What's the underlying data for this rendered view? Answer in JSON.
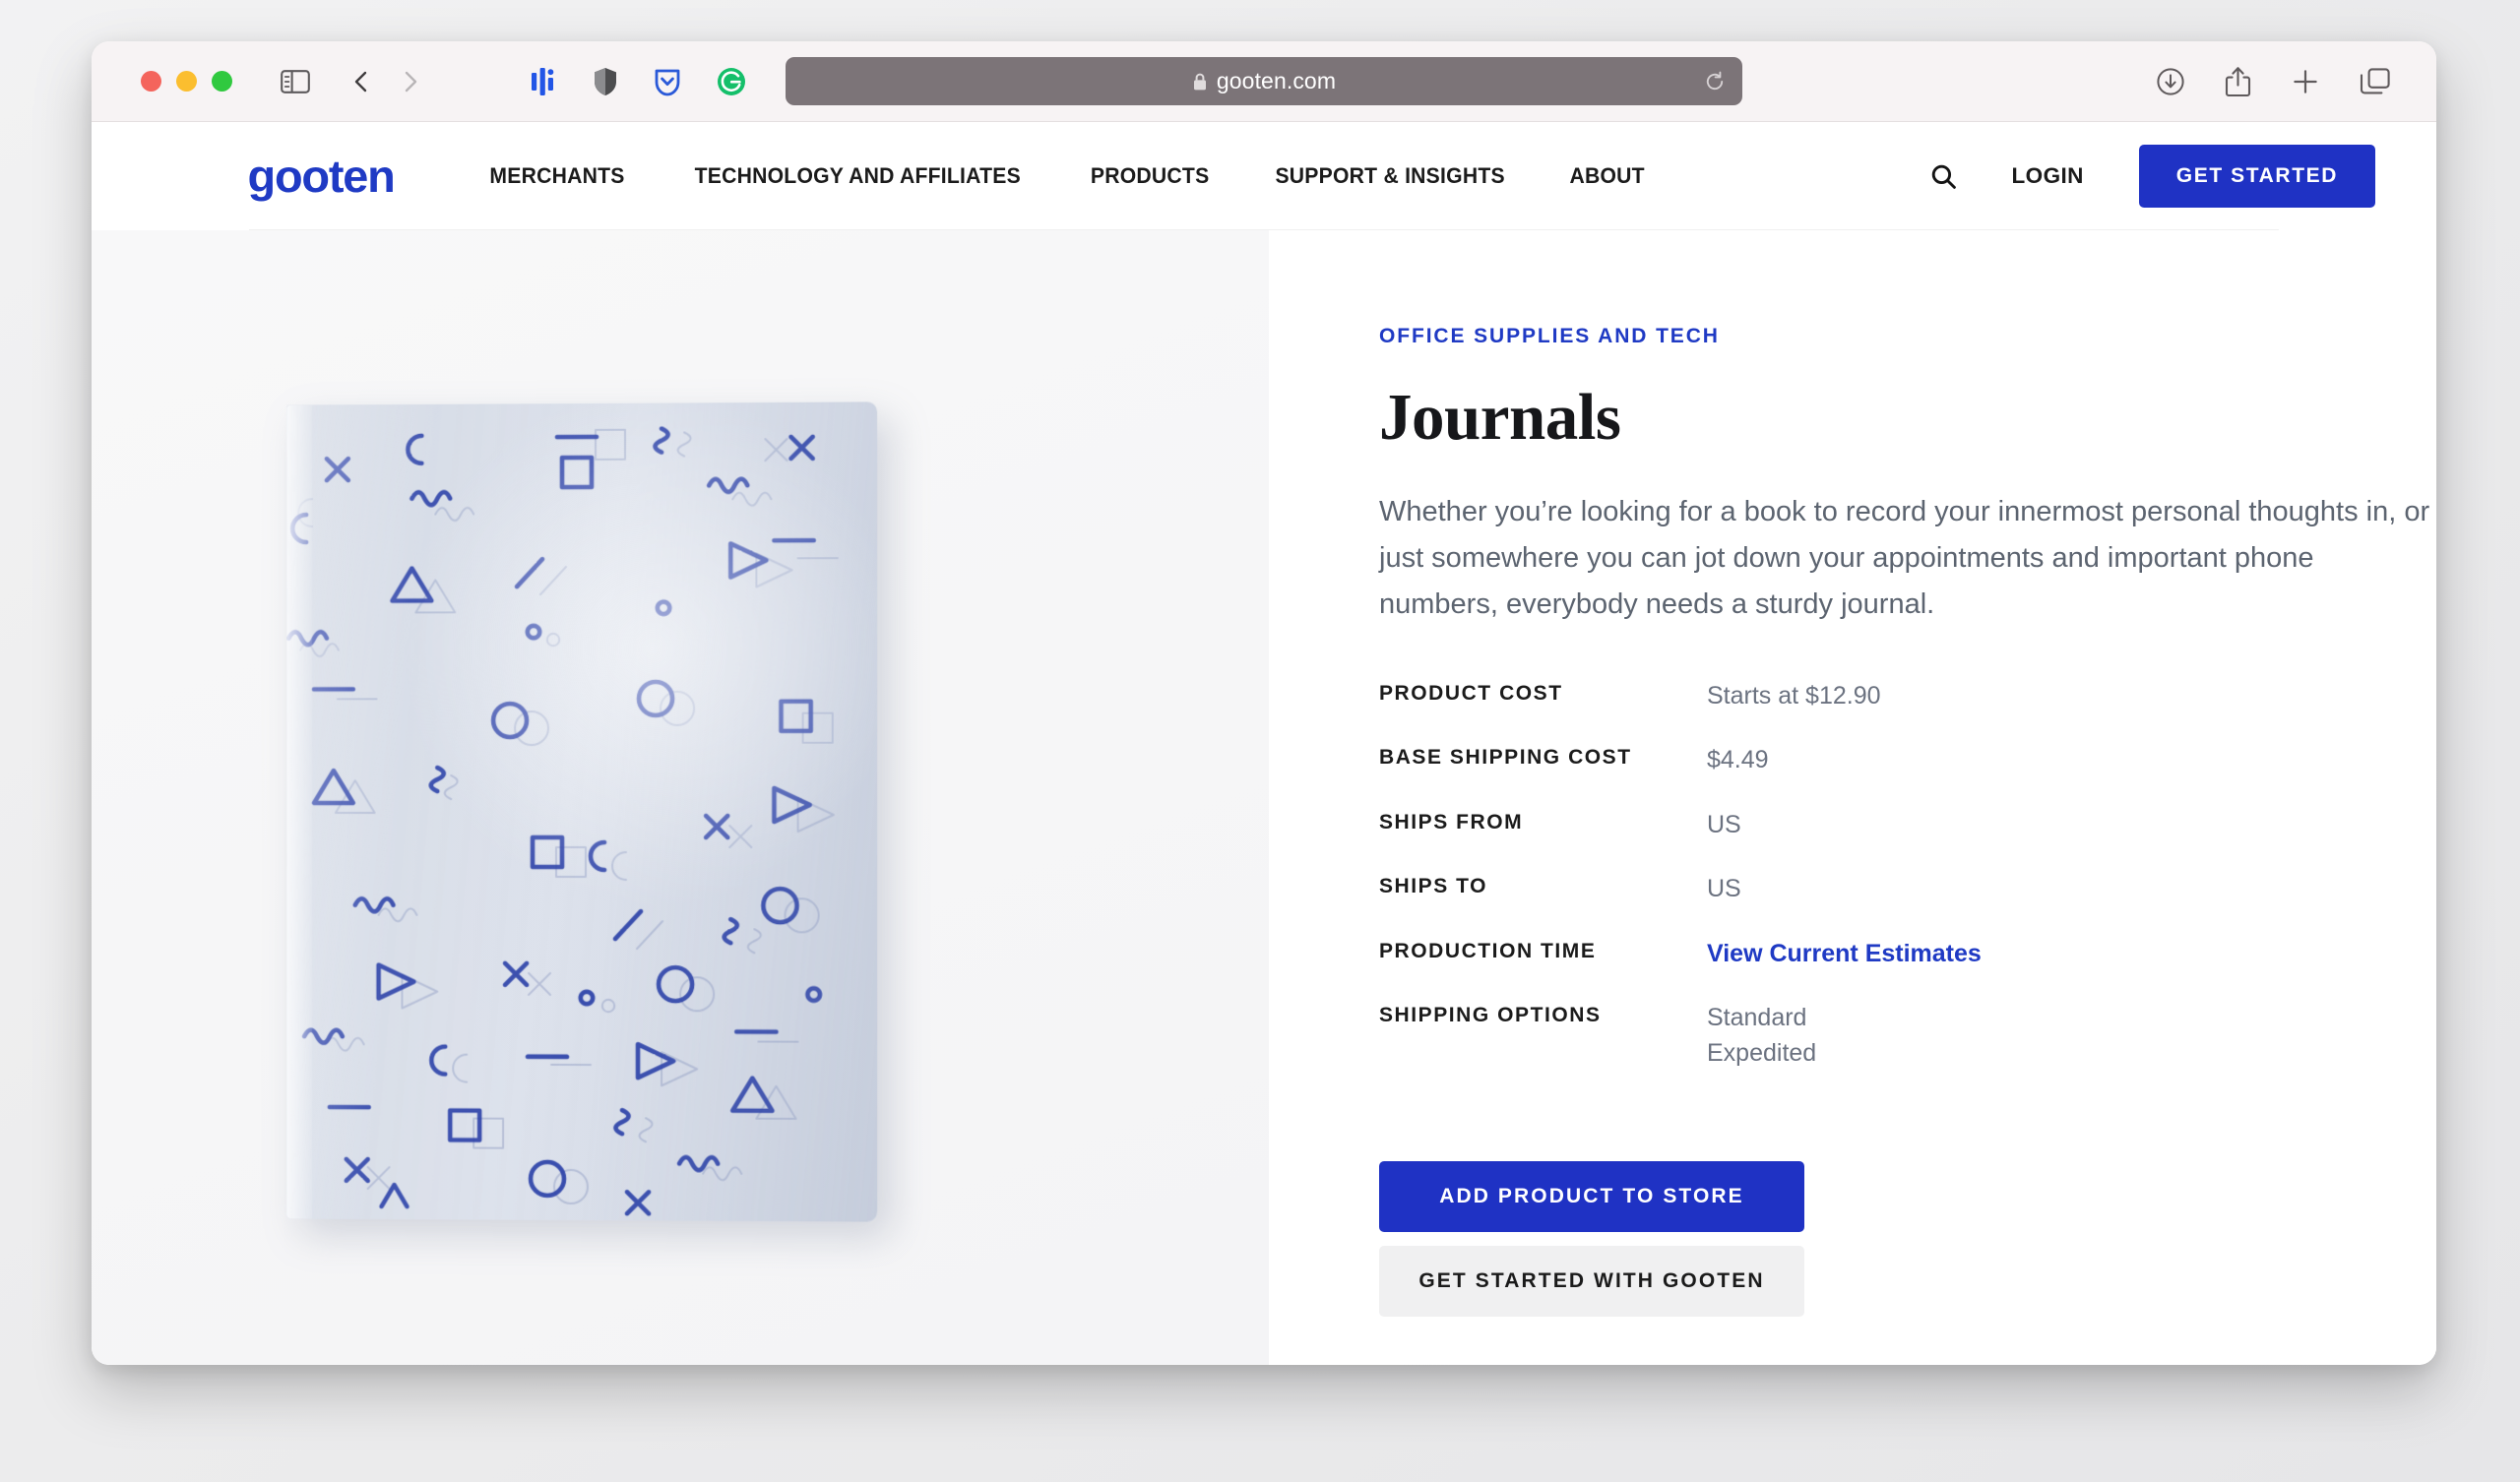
{
  "browser": {
    "traffic_lights": [
      "close",
      "minimize",
      "zoom"
    ],
    "sidebar_icon": "sidebar-icon",
    "back_icon": "chevron-left-icon",
    "forward_icon": "chevron-right-icon",
    "extensions": [
      "honey-extension-icon",
      "ghostery-shield-icon",
      "pocket-extension-icon",
      "grammarly-extension-icon"
    ],
    "address": {
      "lock_icon": "lock-icon",
      "url": "gooten.com",
      "reload_icon": "reload-icon"
    },
    "right_icons": [
      "downloads-icon",
      "share-icon",
      "new-tab-icon",
      "tab-overview-icon"
    ]
  },
  "site": {
    "logo_text": "gooten",
    "nav_items": [
      {
        "label": "MERCHANTS"
      },
      {
        "label": "TECHNOLOGY AND AFFILIATES"
      },
      {
        "label": "PRODUCTS"
      },
      {
        "label": "SUPPORT & INSIGHTS"
      },
      {
        "label": "ABOUT"
      }
    ],
    "search_icon": "search-icon",
    "login_label": "LOGIN",
    "get_started_label": "GET STARTED"
  },
  "product": {
    "category": "OFFICE SUPPLIES AND TECH",
    "title": "Journals",
    "description": "Whether you’re looking for a book to record your innermost personal thoughts in, or just somewhere you can jot down your appointments and important phone numbers, everybody needs a sturdy journal.",
    "specs": [
      {
        "label": "PRODUCT COST",
        "value": "Starts at $12.90",
        "type": "text"
      },
      {
        "label": "BASE SHIPPING COST",
        "value": "$4.49",
        "type": "text"
      },
      {
        "label": "SHIPS FROM",
        "value": "US",
        "type": "text"
      },
      {
        "label": "SHIPS TO",
        "value": "US",
        "type": "text"
      },
      {
        "label": "PRODUCTION TIME",
        "value": "View Current Estimates",
        "type": "link"
      },
      {
        "label": "SHIPPING OPTIONS",
        "value": "Standard",
        "value2": "Expedited",
        "type": "list"
      }
    ],
    "cta_primary": "ADD PRODUCT TO STORE",
    "cta_secondary": "GET STARTED WITH GOOTEN",
    "image_alt": "journal-cover-memphis-pattern"
  },
  "colors": {
    "brand_blue": "#1f3ac4",
    "button_blue": "#1f32c4",
    "pattern_blue": "#2b41a8",
    "text_dark": "#1b1b1b",
    "text_muted": "#6b7280",
    "panel_bg": "#f7f7f8",
    "secondary_btn": "#f0f0f1"
  }
}
